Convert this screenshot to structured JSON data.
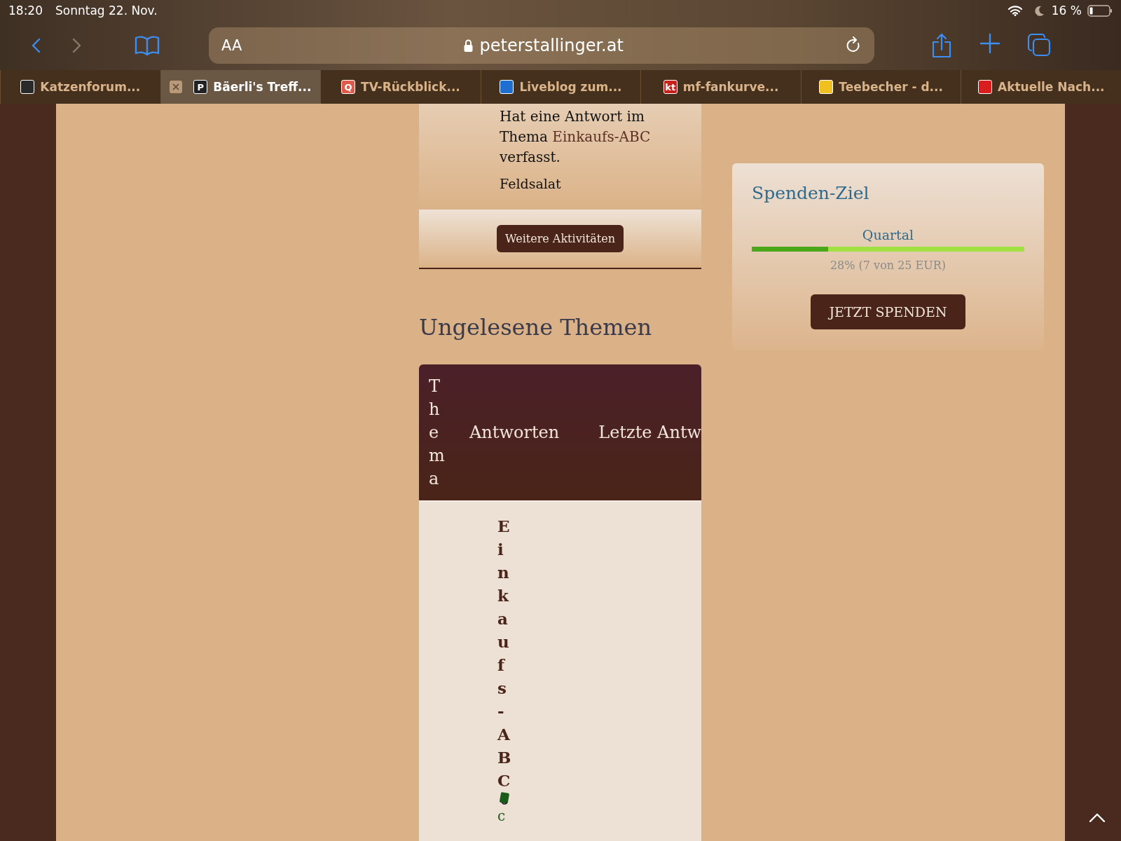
{
  "status_bar": {
    "time": "18:20",
    "date": "Sonntag 22. Nov.",
    "battery": "16 %"
  },
  "nav": [
    {
      "kind": "back",
      "disabled": false
    },
    {
      "kind": "forward",
      "disabled": true
    }
  ],
  "address_bar": {
    "text_size": "AA",
    "url": "peterstallinger.at"
  },
  "tabs": [
    {
      "title": "Katzenforum...",
      "selected": false,
      "color": "#2a2a2a"
    },
    {
      "title": "Bäerli's Treff...",
      "selected": true,
      "color": "#222222",
      "favicon": "P"
    },
    {
      "title": "TV-Rückblick...",
      "selected": false,
      "color": "#e05a4a",
      "favicon": "Q"
    },
    {
      "title": "Liveblog zum...",
      "selected": false,
      "color": "#1e6fd0"
    },
    {
      "title": "mf-fankurve...",
      "selected": false,
      "color": "#c8201a",
      "favicon": "kt"
    },
    {
      "title": "Teebecher - d...",
      "selected": false,
      "color": "#f0c020"
    },
    {
      "title": "Aktuelle Nach...",
      "selected": false,
      "color": "#d81e1e"
    }
  ],
  "activity": {
    "before": "Hat eine Antwort im Thema",
    "link": "Einkaufs-ABC",
    "after": "verfasst.",
    "excerpt": "Feldsalat",
    "more_button": "Weitere Aktivitäten"
  },
  "unread": {
    "title": "Ungelesene Themen",
    "columns": [
      "Thema",
      "Antworten",
      "Letzte Antw"
    ],
    "rows": [
      {
        "title": "Einkaufs-ABC",
        "author": "c"
      }
    ]
  },
  "donation": {
    "title": "Spenden-Ziel",
    "period": "Quartal",
    "level": 0.28,
    "reading": "28% (7 von 25 EUR)",
    "button": "JETZT SPENDEN"
  }
}
